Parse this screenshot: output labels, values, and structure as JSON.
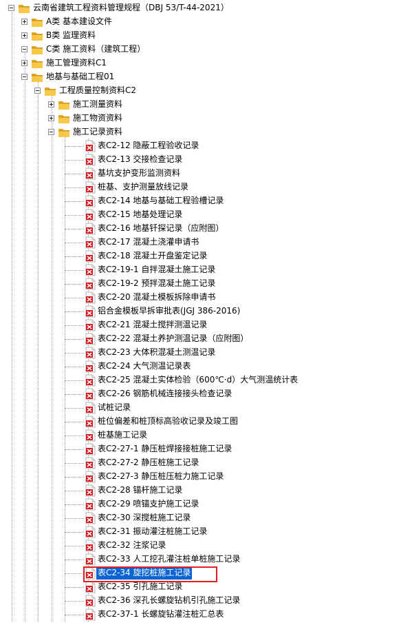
{
  "icon_names": {
    "folder": "folder-icon",
    "document": "pdf-document-icon"
  },
  "selected_item": "表C2-34 旋挖桩施工记录",
  "tree": [
    {
      "label": "云南省建筑工程资料管理规程（DBJ 53/T-44-2021）",
      "depth": 0,
      "type": "folder",
      "toggle": "minus"
    },
    {
      "label": "A类 基本建设文件",
      "depth": 1,
      "type": "folder",
      "toggle": "plus"
    },
    {
      "label": "B类 监理资料",
      "depth": 1,
      "type": "folder",
      "toggle": "plus"
    },
    {
      "label": "C类 施工资料（建筑工程）",
      "depth": 1,
      "type": "folder",
      "toggle": "minus"
    },
    {
      "label": "施工管理资料C1",
      "depth": 2,
      "type": "folder",
      "toggle": "plus"
    },
    {
      "label": "地基与基础工程01",
      "depth": 2,
      "type": "folder",
      "toggle": "minus"
    },
    {
      "label": "工程质量控制资料C2",
      "depth": 3,
      "type": "folder",
      "toggle": "minus"
    },
    {
      "label": "施工测量资料",
      "depth": 4,
      "type": "folder",
      "toggle": "plus"
    },
    {
      "label": "施工物资资料",
      "depth": 4,
      "type": "folder",
      "toggle": "plus"
    },
    {
      "label": "施工记录资料",
      "depth": 4,
      "type": "folder",
      "toggle": "minus"
    },
    {
      "label": "表C2-12 隐蔽工程验收记录",
      "depth": 5,
      "type": "doc"
    },
    {
      "label": "表C2-13 交接检查记录",
      "depth": 5,
      "type": "doc"
    },
    {
      "label": "基坑支护变形监测资料",
      "depth": 5,
      "type": "doc"
    },
    {
      "label": "桩基、支护测量放线记录",
      "depth": 5,
      "type": "doc"
    },
    {
      "label": "表C2-14 地基与基础工程验槽记录",
      "depth": 5,
      "type": "doc"
    },
    {
      "label": "表C2-15 地基处理记录",
      "depth": 5,
      "type": "doc"
    },
    {
      "label": "表C2-16 地基钎探记录（应附图）",
      "depth": 5,
      "type": "doc"
    },
    {
      "label": "表C2-17 混凝土浇灌申请书",
      "depth": 5,
      "type": "doc"
    },
    {
      "label": "表C2-18 混凝土开盘鉴定记录",
      "depth": 5,
      "type": "doc"
    },
    {
      "label": "表C2-19-1 自拌混凝土施工记录",
      "depth": 5,
      "type": "doc"
    },
    {
      "label": "表C2-19-2 预拌混凝土施工记录",
      "depth": 5,
      "type": "doc"
    },
    {
      "label": "表C2-20 混凝土模板拆除申请书",
      "depth": 5,
      "type": "doc"
    },
    {
      "label": "铝合金模板早拆审批表(JGJ 386-2016)",
      "depth": 5,
      "type": "doc"
    },
    {
      "label": "表C2-21 混凝土搅拌测温记录",
      "depth": 5,
      "type": "doc"
    },
    {
      "label": "表C2-22 混凝土养护测温记录（应附图）",
      "depth": 5,
      "type": "doc"
    },
    {
      "label": "表C2-23 大体积混凝土测温记录",
      "depth": 5,
      "type": "doc"
    },
    {
      "label": "表C2-24 大气测温记录表",
      "depth": 5,
      "type": "doc"
    },
    {
      "label": "表C2-25 混凝土实体检验（600℃·d）大气测温统计表",
      "depth": 5,
      "type": "doc"
    },
    {
      "label": "表C2-26 钢筋机械连接接头检查记录",
      "depth": 5,
      "type": "doc"
    },
    {
      "label": "试桩记录",
      "depth": 5,
      "type": "doc"
    },
    {
      "label": "桩位偏差和桩顶标高验收记录及竣工图",
      "depth": 5,
      "type": "doc"
    },
    {
      "label": "桩基施工记录",
      "depth": 5,
      "type": "doc"
    },
    {
      "label": "表C2-27-1 静压桩焊接接桩施工记录",
      "depth": 5,
      "type": "doc"
    },
    {
      "label": "表C2-27-2 静压桩施工记录",
      "depth": 5,
      "type": "doc"
    },
    {
      "label": "表C2-27-3 静压桩压桩力施工记录",
      "depth": 5,
      "type": "doc"
    },
    {
      "label": "表C2-28 锚杆施工记录",
      "depth": 5,
      "type": "doc"
    },
    {
      "label": "表C2-29 喷锚支护施工记录",
      "depth": 5,
      "type": "doc"
    },
    {
      "label": "表C2-30 深搅桩施工记录",
      "depth": 5,
      "type": "doc"
    },
    {
      "label": "表C2-31 振动灌注桩施工记录",
      "depth": 5,
      "type": "doc"
    },
    {
      "label": "表C2-32 注浆记录",
      "depth": 5,
      "type": "doc"
    },
    {
      "label": "表C2-33 人工挖孔灌注桩单桩施工记录",
      "depth": 5,
      "type": "doc"
    },
    {
      "label": "表C2-34 旋挖桩施工记录",
      "depth": 5,
      "type": "doc",
      "selected": true
    },
    {
      "label": "表C2-35 引孔施工记录",
      "depth": 5,
      "type": "doc"
    },
    {
      "label": "表C2-36 深孔长螺旋钻机引孔施工记录",
      "depth": 5,
      "type": "doc"
    },
    {
      "label": "表C2-37-1 长螺旋钻灌注桩汇总表",
      "depth": 5,
      "type": "doc"
    }
  ]
}
